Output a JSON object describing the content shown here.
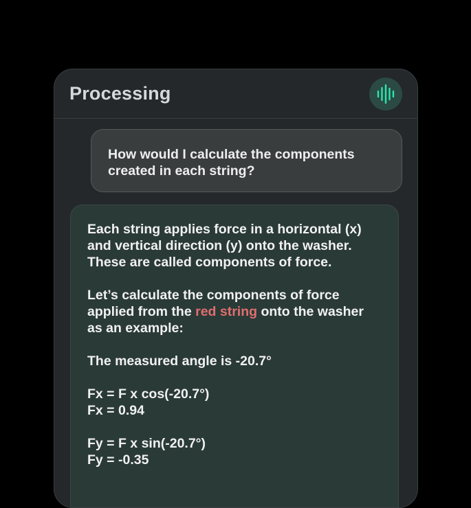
{
  "header": {
    "title": "Processing",
    "voice_icon": "waveform-icon",
    "accent": "#2ee6a8"
  },
  "user_message": {
    "text": "How would I calculate the components created in each string?"
  },
  "assistant_message": {
    "p1": "Each string applies force in a horizontal (x) and vertical direction (y) onto the washer. These are called components of force.",
    "p2_before": "Let’s calculate the components of force applied from the ",
    "p2_highlight": "red string",
    "p2_after": " onto the washer as an example:",
    "highlight_color": "#e06f6f",
    "angle_line": "The measured angle is -20.7°",
    "fx_formula": "Fx = F x cos(-20.7°)",
    "fx_value": "Fx = 0.94",
    "fy_formula": "Fy = F x sin(-20.7°)",
    "fy_value": "Fy = -0.35"
  }
}
